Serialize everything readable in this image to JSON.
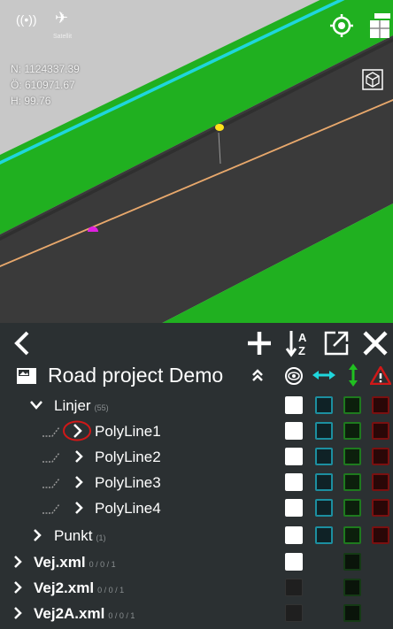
{
  "viewport": {
    "status_icons": [
      "signal-icon",
      "satellite-icon"
    ],
    "satellite_label": "Satellit",
    "coords": {
      "north": "N: 1124337.39",
      "east": "Ö: 610971.67",
      "height": "H: 99.76"
    }
  },
  "panel": {
    "project": {
      "title": "Road project Demo"
    },
    "column_icons": [
      "eye-icon",
      "horizontal-arrows-icon",
      "vertical-arrows-icon",
      "warning-icon"
    ],
    "folders": [
      {
        "label": "Linjer",
        "count": "(55)"
      },
      {
        "label": "Punkt",
        "count": "(1)"
      }
    ],
    "polylines": [
      {
        "label": "PolyLine1"
      },
      {
        "label": "PolyLine2"
      },
      {
        "label": "PolyLine3"
      },
      {
        "label": "PolyLine4"
      }
    ],
    "files": [
      {
        "label": "Vej.xml",
        "stats": "0 / 0 / 1"
      },
      {
        "label": "Vej2.xml",
        "stats": "0 / 0 / 1"
      },
      {
        "label": "Vej2A.xml",
        "stats": "0 / 0 / 1"
      }
    ]
  },
  "colors": {
    "accent_cyan": "#1fd6dc",
    "accent_green": "#20c020",
    "warning_red": "#d01818",
    "road_green": "#27b327"
  }
}
